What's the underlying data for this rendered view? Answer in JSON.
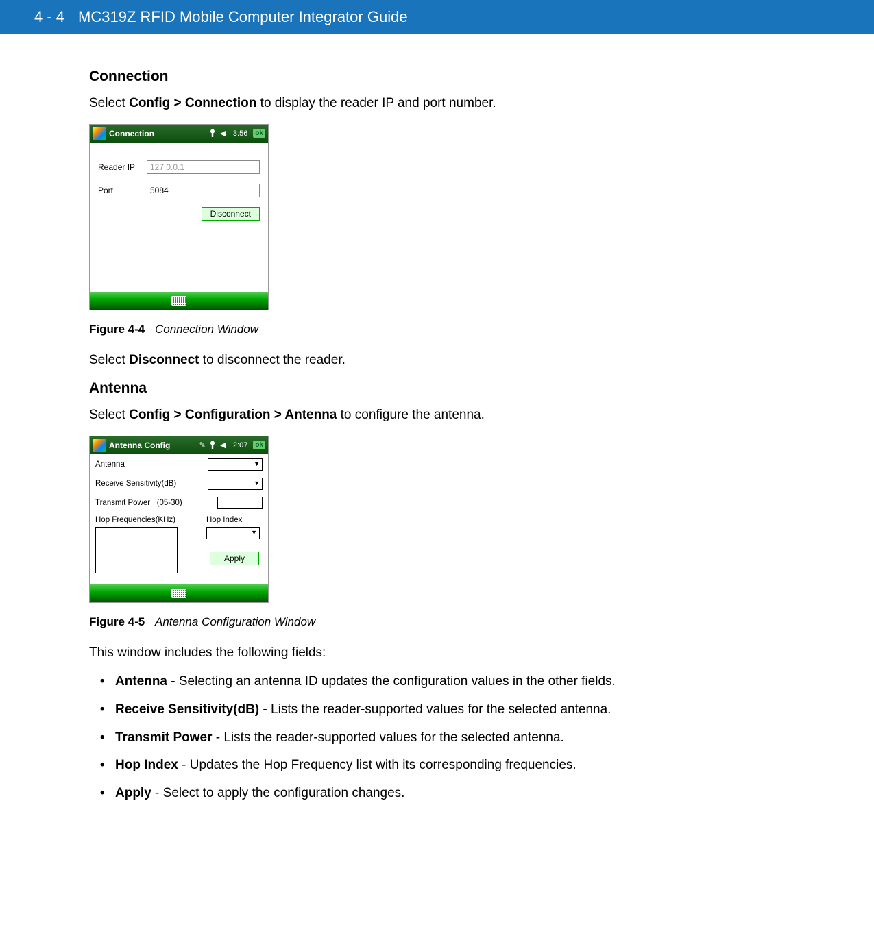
{
  "header": {
    "page_num": "4 - 4",
    "title": "MC319Z RFID Mobile Computer Integrator Guide"
  },
  "sections": {
    "connection": {
      "title": "Connection",
      "intro_prefix": "Select ",
      "intro_bold": "Config > Connection",
      "intro_suffix": " to display the reader IP and port number.",
      "after_prefix": "Select ",
      "after_bold": "Disconnect",
      "after_suffix": " to disconnect the reader."
    },
    "antenna": {
      "title": "Antenna",
      "intro_prefix": "Select ",
      "intro_bold": "Config > Configuration > Antenna",
      "intro_suffix": " to configure the antenna.",
      "fields_intro": "This window includes the following fields:"
    }
  },
  "figures": {
    "f44": {
      "id": "Figure 4-4",
      "title": "Connection Window"
    },
    "f45": {
      "id": "Figure 4-5",
      "title": "Antenna Configuration Window"
    }
  },
  "wm_connection": {
    "title": "Connection",
    "time": "3:56",
    "ok": "ok",
    "reader_ip_label": "Reader IP",
    "reader_ip_value": "127.0.0.1",
    "port_label": "Port",
    "port_value": "5084",
    "disconnect": "Disconnect"
  },
  "wm_antenna": {
    "title": "Antenna Config",
    "time": "2:07",
    "ok": "ok",
    "antenna_label": "Antenna",
    "recv_label": "Receive Sensitivity(dB)",
    "tx_label": "Transmit Power",
    "tx_range": "(05-30)",
    "hop_freq_label": "Hop Frequencies(KHz)",
    "hop_index_label": "Hop Index",
    "apply": "Apply"
  },
  "field_list": [
    {
      "term": "Antenna",
      "desc": " - Selecting an antenna ID updates the configuration values in the other fields."
    },
    {
      "term": "Receive Sensitivity(dB)",
      "desc": " - Lists the reader-supported values for the selected antenna."
    },
    {
      "term": "Transmit Power",
      "desc": " - Lists the reader-supported values for the selected antenna."
    },
    {
      "term": "Hop Index",
      "desc": " - Updates the Hop Frequency list with its corresponding frequencies."
    },
    {
      "term": "Apply",
      "desc": " - Select to apply the configuration changes."
    }
  ]
}
